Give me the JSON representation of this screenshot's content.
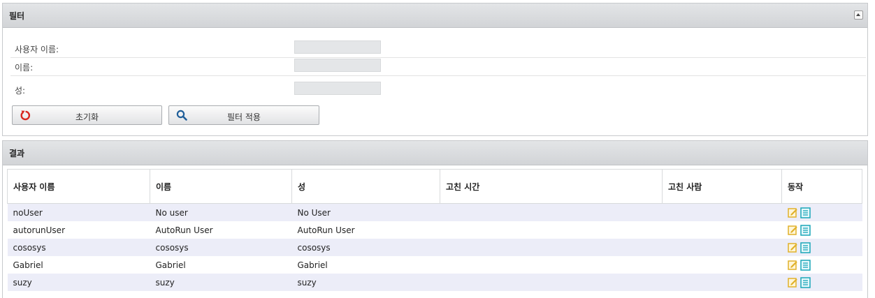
{
  "filter": {
    "title": "필터",
    "fields": [
      {
        "label": "사용자 이름:",
        "value": ""
      },
      {
        "label": "이름:",
        "value": ""
      },
      {
        "label": "성:",
        "value": ""
      }
    ],
    "reset_label": "초기화",
    "apply_label": "필터 적용"
  },
  "results": {
    "title": "결과",
    "columns": [
      "사용자 이름",
      "이름",
      "성",
      "고친 시간",
      "고친 사람",
      "동작"
    ],
    "rows": [
      {
        "username": "noUser",
        "first_name": "No user",
        "last_name": "No User",
        "modified_time": "",
        "modified_by": ""
      },
      {
        "username": "autorunUser",
        "first_name": "AutoRun User",
        "last_name": "AutoRun User",
        "modified_time": "",
        "modified_by": ""
      },
      {
        "username": "cososys",
        "first_name": "cososys",
        "last_name": "cososys",
        "modified_time": "",
        "modified_by": ""
      },
      {
        "username": "Gabriel",
        "first_name": "Gabriel",
        "last_name": "Gabriel",
        "modified_time": "",
        "modified_by": ""
      },
      {
        "username": "suzy",
        "first_name": "suzy",
        "last_name": "suzy",
        "modified_time": "",
        "modified_by": ""
      }
    ]
  },
  "colors": {
    "row_alt": "#ecedf8",
    "edit_icon": "#e0b12a",
    "details_icon": "#1aa6b8",
    "reset_icon": "#d8261f",
    "search_icon": "#1f5e99"
  },
  "icons": [
    "collapse-up-icon",
    "reset-icon",
    "search-icon",
    "edit-icon",
    "details-icon"
  ]
}
